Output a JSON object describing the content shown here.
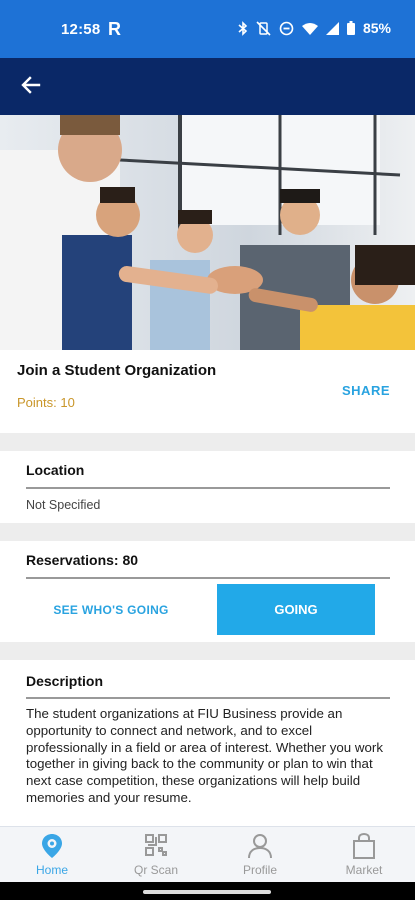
{
  "status_bar": {
    "time": "12:58",
    "carrier_glyph": "R",
    "battery": "85%",
    "icons": [
      "bluetooth-icon",
      "vibrate-off-icon",
      "do-not-disturb-icon",
      "wifi-icon",
      "signal-icon",
      "battery-icon"
    ]
  },
  "app_bar": {
    "back_icon": "arrow-left-icon"
  },
  "event": {
    "title": "Join a Student Organization",
    "points": "Points: 10",
    "share_label": "SHARE"
  },
  "location": {
    "label": "Location",
    "value": "Not Specified"
  },
  "reservations": {
    "label": "Reservations: 80",
    "see_who_label": "SEE WHO'S GOING",
    "going_label": "GOING"
  },
  "description": {
    "label": "Description",
    "text": "The student organizations at FIU Business provide an opportunity to connect and network, and to excel professionally in a field or area of interest. Whether you work together in giving back to the community or plan to win that next case competition, these organizations will help build memories and your resume."
  },
  "bottom_nav": {
    "items": [
      {
        "label": "Home",
        "icon": "location-pin-icon",
        "active": true
      },
      {
        "label": "Qr Scan",
        "icon": "qr-code-icon",
        "active": false
      },
      {
        "label": "Profile",
        "icon": "person-icon",
        "active": false
      },
      {
        "label": "Market",
        "icon": "shopping-bag-icon",
        "active": false
      }
    ]
  },
  "colors": {
    "status_bar": "#1e72d6",
    "app_bar": "#0a2867",
    "accent": "#22a9e8",
    "points": "#c9962a"
  }
}
